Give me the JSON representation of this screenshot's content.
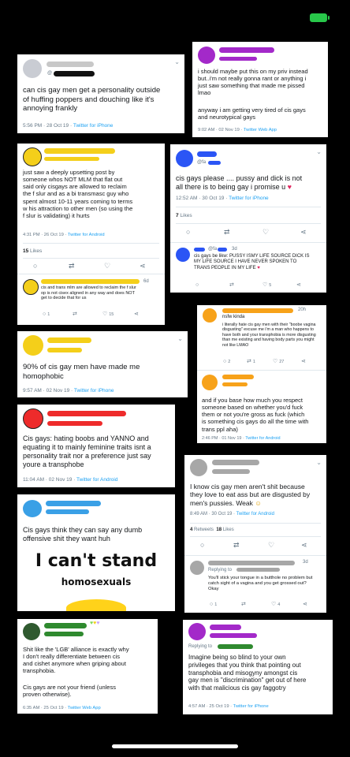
{
  "status_bar": {
    "battery_icon": "battery-charging-icon",
    "battery_color": "#28c84a"
  },
  "tweets": {
    "t1": {
      "handle": "@",
      "text": "can cis gay men get a personality outside\nof huffing poppers and douching like it's\nannoying frankly",
      "time": "5:56 PM · 28 Oct 19 · ",
      "source": "Twitter for iPhone"
    },
    "t2": {
      "text": "i should maybe put this on my priv instead\nbut..i'm not really gonna rant or anything i\njust saw something that made me pissed\nlmao",
      "text2": "anyway i am getting very tired of cis gays\nand neurotypical gays",
      "time": "9:02 AM · 02 Nov 19 · ",
      "source": "Twitter Web App"
    },
    "t3": {
      "text": "just saw a deeply upsetting post by\nsomeone whos NOT MLM that flat out\nsaid only cisgays are allowed to reclaim\nthe f slur and as a bi transmasc guy who\nspent almost 10-11 years coming to terms\nw his attraction to other men (so using the\nf slur is validating) it hurts",
      "time": "4:31 PM · 26 Oct 19 · ",
      "source": "Twitter for Android",
      "likes_count": "15",
      "likes_label": "Likes",
      "reply_time": "6d",
      "reply_text": "cis and trans mlm are allowed to reclaim the f slur\nop is not cisex aligned in any way and does NOT\nget to decide that for us",
      "reply_likes": "1",
      "reply_retweets": "15"
    },
    "t4": {
      "handle": "@fa",
      "text": "cis gays please .... pussy and dick is not\nall there is to being gay i promise u",
      "time": "12:52 AM · 30 Oct 19 · ",
      "source": "Twitter for iPhone",
      "likes_count": "7",
      "likes_label": "Likes",
      "reply_handle": "@fa",
      "reply_time": "3d",
      "reply_text": "cis gays be likw: PUSSY ISMY LIFE SOURCE DICK IS\nMY LIFE SOURCE I HAVE NEVER SPOKEN TO\nTRANS PEOPLE IN MY LIFE",
      "reply_count": "5"
    },
    "t5": {
      "time": "20h",
      "subtitle": "nsfw kinda",
      "text": "i literally hate cis gay men with their \"boobe vagina\ndisgusting\" excuse me i'm a man who happens to\nhave both and your transphobia is more disgusting\nthan me existing and having body parts you might\nnot like LMAO",
      "replies": "2",
      "retweets": "1",
      "likes": "27"
    },
    "t6": {
      "text": "and if you base how much you respect\nsomeone based on whether you'd fuck\nthem or not you're gross as fuck (which\nis something cis gays do all the time with\ntrans ppl aha)",
      "time": "2:46 PM · 01 Nov 19 · ",
      "source": "Twitter for Android"
    },
    "t7": {
      "text": "90% of cis gay men have made me\nhomophobic",
      "time": "9:57 AM · 02 Nov 19 · ",
      "source": "Twitter for iPhone"
    },
    "t8": {
      "text": "Cis gays: hating boobs and YANNO and\nequating it to mainly feminine traits isnt a\npersonality trait nor a preference just say\nyoure a transphobe",
      "time": "11:04 AM · 02 Nov 19 · ",
      "source": "Twitter for Android"
    },
    "t9": {
      "text": "I know cis gay men aren't shit because\nthey love to eat ass but are  disgusted by\nmen's pussies. Weak",
      "time": "8:49 AM · 30 Oct 19 · ",
      "source": "Twitter for Android",
      "retweets_count": "4",
      "retweets_label": "Retweets",
      "likes_count": "18",
      "likes_label": "Likes",
      "reply_prefix": "Replying to",
      "reply_time": "3d",
      "reply_text": "You'll stick your tongue in a butthole no problem but\ncatch sight of a vagina and you get grossed out?\nOkay",
      "reply_count": "4",
      "reply_replies": "1"
    },
    "t10": {
      "text": "Cis gays think they can say any dumb\noffensive shit they want huh",
      "meme_line1": "I can't stand",
      "meme_line2": "homosexuals"
    },
    "t11": {
      "text": "Shit like the 'LGB' alliance is exactly why\nI don't really differentiate between cis\nand cishet anymore when griping about\ntransphobia.",
      "text2": "Cis gays are not your friend (unless\nproven otherwise).",
      "time": "6:35 AM · 25 Oct 19 · ",
      "source": "Twitter Web App"
    },
    "t12": {
      "reply_prefix": "Replying to",
      "text": "Imagine being so blind to your own\nprivileges that you think that pointing out\ntransphobia and misogyny amongst cis\ngay men is \"discrimination\" get out of here\nwith that malicious cis gay faggotry",
      "time": "4:57 AM · 25 Oct 19 · ",
      "source": "Twitter for iPhone"
    }
  },
  "colors": {
    "twitter_blue": "#1da1f2",
    "meta_gray": "#657786",
    "heart_red": "#e0245e",
    "scribble_black": "#111111",
    "scribble_purple": "#a329c9",
    "scribble_yellow": "#f4cf1a",
    "scribble_blue": "#2b55f5",
    "scribble_orange": "#f7a21a",
    "scribble_red": "#ee2b2b",
    "scribble_green": "#2f8a2f",
    "scribble_gray": "#a7a7a7"
  }
}
